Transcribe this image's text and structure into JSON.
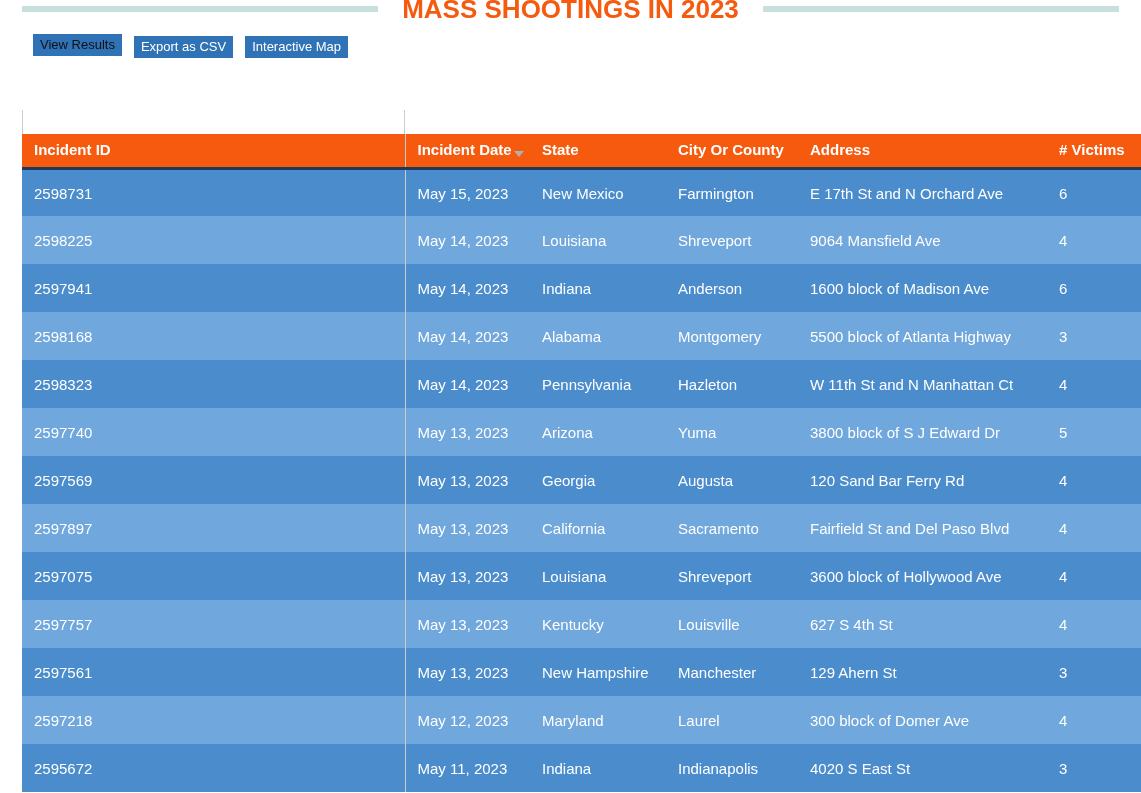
{
  "title": "MASS SHOOTINGS IN 2023",
  "buttons": [
    {
      "label": "View Results",
      "selected": true
    },
    {
      "label": "Export as CSV",
      "selected": false
    },
    {
      "label": "Interactive Map",
      "selected": false
    }
  ],
  "table": {
    "columns": [
      {
        "label": "Incident ID",
        "sorted": false
      },
      {
        "label": "Incident Date",
        "sorted": true
      },
      {
        "label": "State",
        "sorted": false
      },
      {
        "label": "City Or County",
        "sorted": false
      },
      {
        "label": "Address",
        "sorted": false
      },
      {
        "label": "# Victims",
        "sorted": false
      }
    ],
    "rows": [
      [
        "2598731",
        "May 15, 2023",
        "New Mexico",
        "Farmington",
        "E 17th St and N Orchard Ave",
        "6"
      ],
      [
        "2598225",
        "May 14, 2023",
        "Louisiana",
        "Shreveport",
        "9064 Mansfield Ave",
        "4"
      ],
      [
        "2597941",
        "May 14, 2023",
        "Indiana",
        "Anderson",
        "1600 block of Madison Ave",
        "6"
      ],
      [
        "2598168",
        "May 14, 2023",
        "Alabama",
        "Montgomery",
        "5500 block of Atlanta Highway",
        "3"
      ],
      [
        "2598323",
        "May 14, 2023",
        "Pennsylvania",
        "Hazleton",
        "W 11th St and N Manhattan Ct",
        "4"
      ],
      [
        "2597740",
        "May 13, 2023",
        "Arizona",
        "Yuma",
        "3800 block of S J Edward Dr",
        "5"
      ],
      [
        "2597569",
        "May 13, 2023",
        "Georgia",
        "Augusta",
        "120 Sand Bar Ferry Rd",
        "4"
      ],
      [
        "2597897",
        "May 13, 2023",
        "California",
        "Sacramento",
        "Fairfield St and Del Paso Blvd",
        "4"
      ],
      [
        "2597075",
        "May 13, 2023",
        "Louisiana",
        "Shreveport",
        "3600 block of Hollywood Ave",
        "4"
      ],
      [
        "2597757",
        "May 13, 2023",
        "Kentucky",
        "Louisville",
        "627 S 4th St",
        "4"
      ],
      [
        "2597561",
        "May 13, 2023",
        "New Hampshire",
        "Manchester",
        "129 Ahern St",
        "3"
      ],
      [
        "2597218",
        "May 12, 2023",
        "Maryland",
        "Laurel",
        "300 block of Domer Ave",
        "4"
      ],
      [
        "2595672",
        "May 11, 2023",
        "Indiana",
        "Indianapolis",
        "4020 S East St",
        "3"
      ]
    ]
  }
}
